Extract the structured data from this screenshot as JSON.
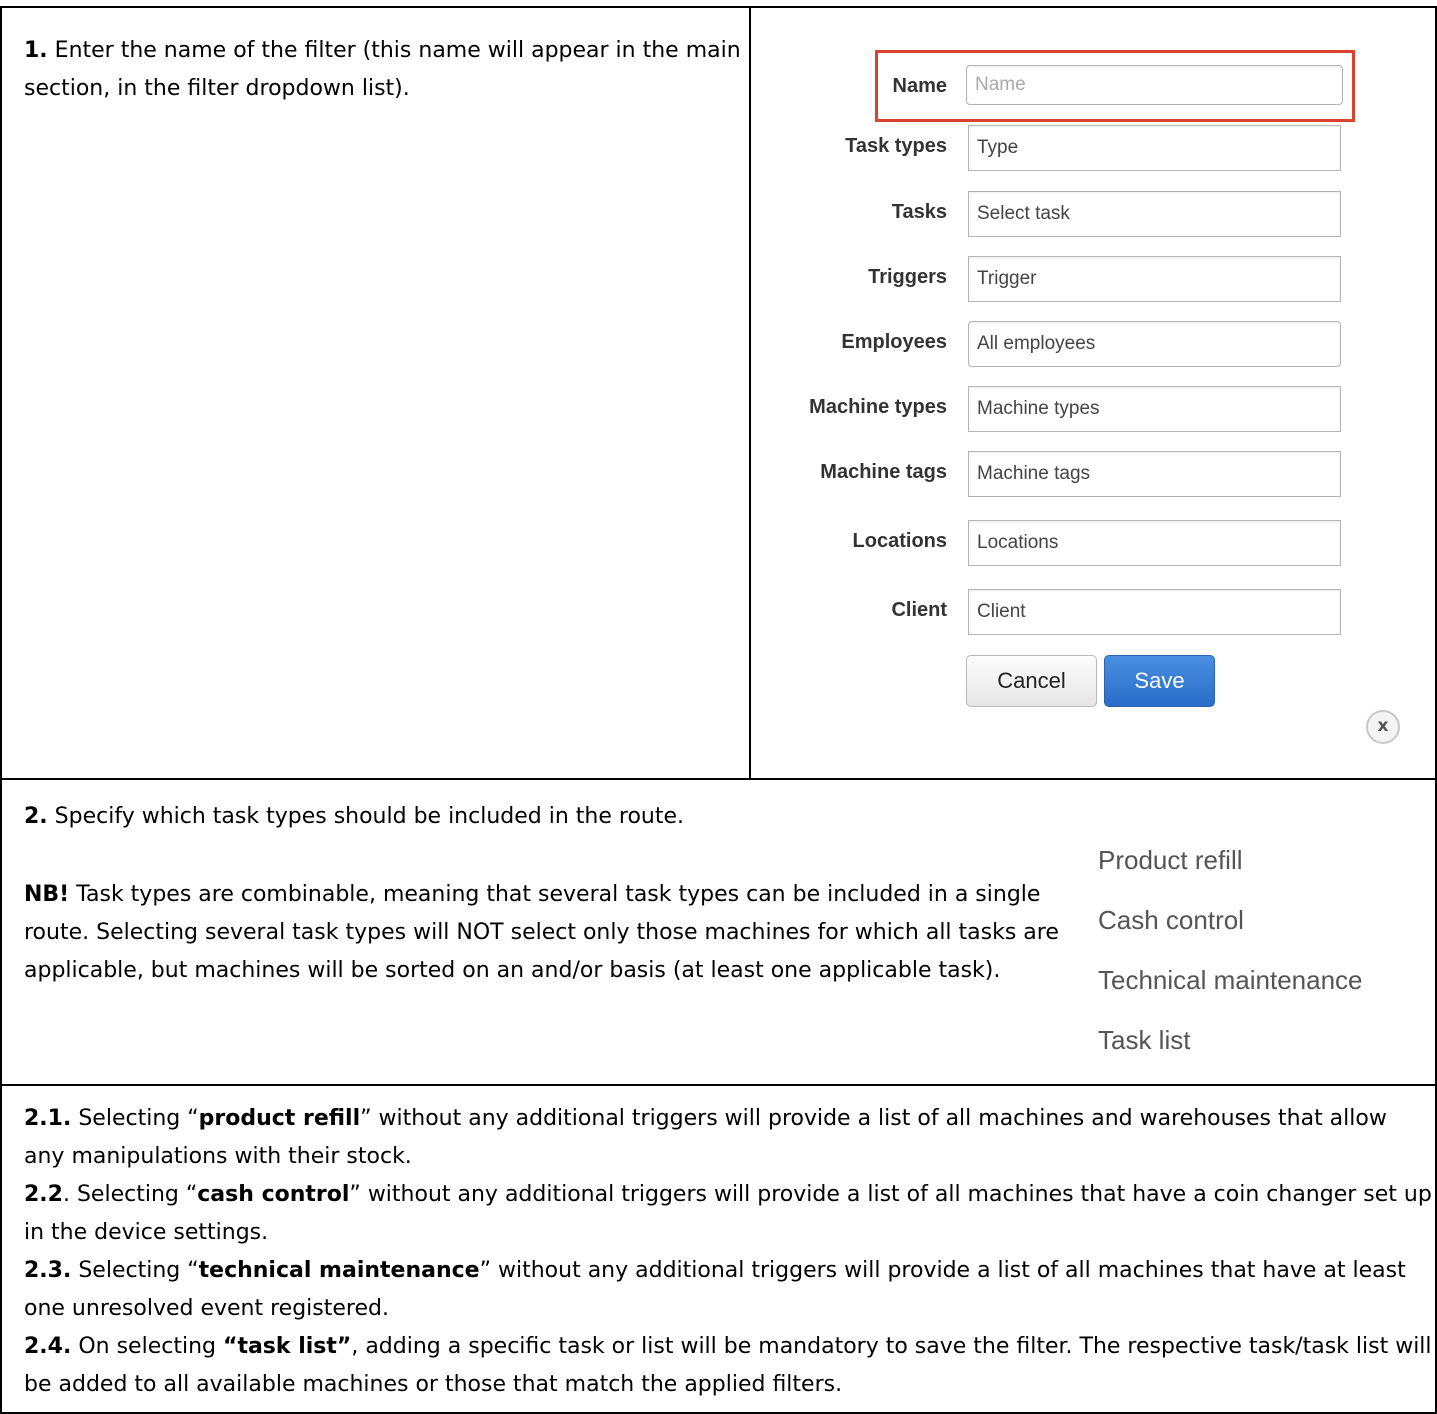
{
  "section1": {
    "num": "1.",
    "text": " Enter the name of the filter (this name will appear in the main section, in the filter dropdown list)."
  },
  "form": {
    "fields": [
      {
        "label": "Name",
        "value": "Name",
        "is_placeholder": true
      },
      {
        "label": "Task types",
        "value": "Type"
      },
      {
        "label": "Tasks",
        "value": "Select task"
      },
      {
        "label": "Triggers",
        "value": "Trigger"
      },
      {
        "label": "Employees",
        "value": "All employees"
      },
      {
        "label": "Machine types",
        "value": "Machine types"
      },
      {
        "label": "Machine tags",
        "value": "Machine tags"
      },
      {
        "label": "Locations",
        "value": "Locations"
      },
      {
        "label": "Client",
        "value": "Client"
      }
    ],
    "cancel_label": "Cancel",
    "save_label": "Save",
    "close_symbol": "x",
    "highlight_color": "#d9442f",
    "save_color": "#2a6dc9"
  },
  "section2": {
    "num": "2.",
    "text": " Specify which task types should be included in the route.",
    "nb_label": "NB!",
    "nb_text": " Task types are combinable, meaning that several task types can be included in a single route. Selecting several task types will NOT select only those machines for which all tasks are applicable, but machines will be sorted on an and/or basis (at least one applicable task).",
    "task_types": [
      "Product refill",
      "Cash control",
      "Technical maintenance",
      "Task list"
    ]
  },
  "section3": {
    "items": [
      {
        "num": "2.1.",
        "pre": " Selecting “",
        "bold": "product refill",
        "post": "” without any additional triggers will provide a list of all machines and warehouses that allow any manipulations with their stock."
      },
      {
        "num": "2.2",
        "pre": ". Selecting “",
        "bold": "cash control",
        "post": "” without any additional triggers will provide a list of all machines that have a coin changer set up in the device settings."
      },
      {
        "num": "2.3.",
        "pre": " Selecting “",
        "bold": "technical maintenance",
        "post": "” without any additional triggers will provide a list of all machines that have at least one unresolved event registered."
      },
      {
        "num": "2.4.",
        "pre": " On selecting ",
        "bold": "“task list”",
        "post": ", adding a specific task or list will be mandatory to save the filter. The respective task/task list will be added to all available machines or those that match the applied filters."
      }
    ]
  }
}
